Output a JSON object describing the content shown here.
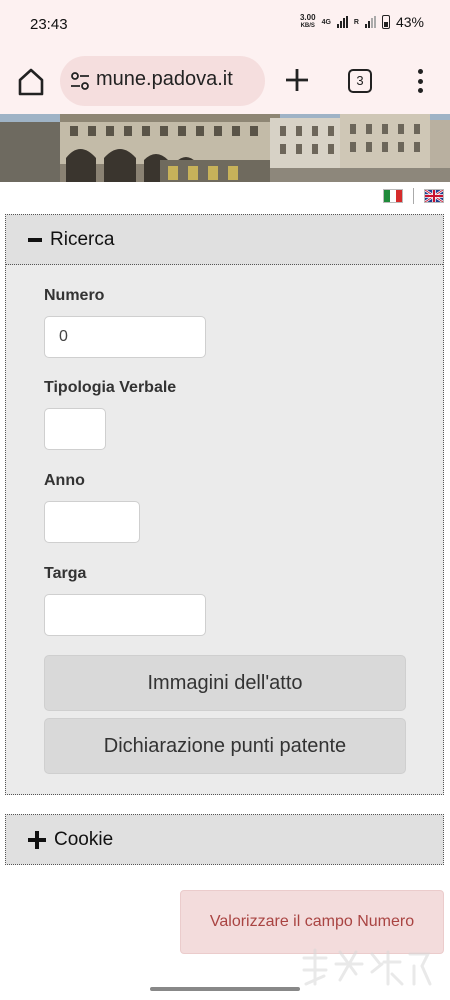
{
  "status_bar": {
    "time": "23:43",
    "net_speed_value": "3.00",
    "net_speed_unit": "KB/S",
    "network_type": "4G",
    "roaming": "R",
    "battery_percent": "43%"
  },
  "browser": {
    "url": "mune.padova.it",
    "tab_count": "3",
    "icons": [
      "home-icon",
      "tune-icon",
      "new-tab-icon",
      "tab-switcher-icon",
      "more-vert-icon"
    ]
  },
  "languages": [
    "italian-flag",
    "english-flag"
  ],
  "ricerca": {
    "title": "Ricerca",
    "fields": {
      "numero": {
        "label": "Numero",
        "value": "0"
      },
      "tipologia": {
        "label": "Tipologia Verbale",
        "value": ""
      },
      "anno": {
        "label": "Anno",
        "value": ""
      },
      "targa": {
        "label": "Targa",
        "value": ""
      }
    },
    "buttons": {
      "immagini": "Immagini dell'atto",
      "dichiarazione": "Dichiarazione punti patente"
    }
  },
  "cookie": {
    "title": "Cookie"
  },
  "alert": {
    "message": "Valorizzare il campo Numero"
  },
  "colors": {
    "chrome_bg": "#fdf1f1",
    "url_pill": "#f5dede",
    "panel_bg": "#ebebeb",
    "alert_bg": "#f3dcdc",
    "alert_text": "#a94442"
  }
}
